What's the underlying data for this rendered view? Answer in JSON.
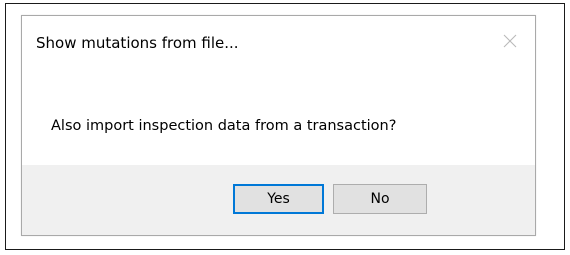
{
  "dialog": {
    "title": "Show mutations from file...",
    "close_icon": "close-icon",
    "message": "Also import inspection data from a transaction?",
    "buttons": {
      "yes_label": "Yes",
      "no_label": "No"
    }
  },
  "colors": {
    "footer_background": "#f0f0f0",
    "button_background": "#e1e1e1",
    "default_button_border": "#0078d7"
  }
}
